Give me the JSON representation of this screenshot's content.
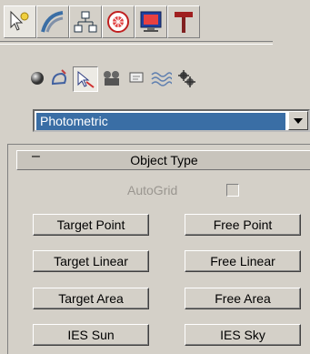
{
  "tabs": [
    {
      "name": "create-tab",
      "icon": "star-pointer-icon",
      "active": true
    },
    {
      "name": "modify-tab",
      "icon": "modify-curve-icon",
      "active": false
    },
    {
      "name": "hierarchy-tab",
      "icon": "hierarchy-icon",
      "active": false
    },
    {
      "name": "motion-tab",
      "icon": "motion-icon",
      "active": false
    },
    {
      "name": "display-tab",
      "icon": "display-monitor-icon",
      "active": false
    },
    {
      "name": "utilities-tab",
      "icon": "hammer-icon",
      "active": false
    }
  ],
  "categories": [
    {
      "name": "geometry",
      "icon": "sphere-icon",
      "active": false
    },
    {
      "name": "shapes",
      "icon": "shapes-icon",
      "active": false
    },
    {
      "name": "lights",
      "icon": "light-icon",
      "active": true
    },
    {
      "name": "cameras",
      "icon": "camera-icon",
      "active": false
    },
    {
      "name": "helpers",
      "icon": "helper-icon",
      "active": false
    },
    {
      "name": "space-warps",
      "icon": "wave-icon",
      "active": false
    },
    {
      "name": "systems",
      "icon": "gears-icon",
      "active": false
    }
  ],
  "dropdown": {
    "selected": "Photometric"
  },
  "rollout": {
    "title": "Object Type",
    "collapse_symbol": "–",
    "autogrid_label": "AutoGrid",
    "autogrid_checked": false
  },
  "buttons": [
    {
      "label": "Target Point"
    },
    {
      "label": "Free Point"
    },
    {
      "label": "Target Linear"
    },
    {
      "label": "Free Linear"
    },
    {
      "label": "Target Area"
    },
    {
      "label": "Free Area"
    },
    {
      "label": "IES Sun"
    },
    {
      "label": "IES Sky"
    }
  ],
  "colors": {
    "panel": "#d4d0c8",
    "selection": "#3a6ea5"
  }
}
